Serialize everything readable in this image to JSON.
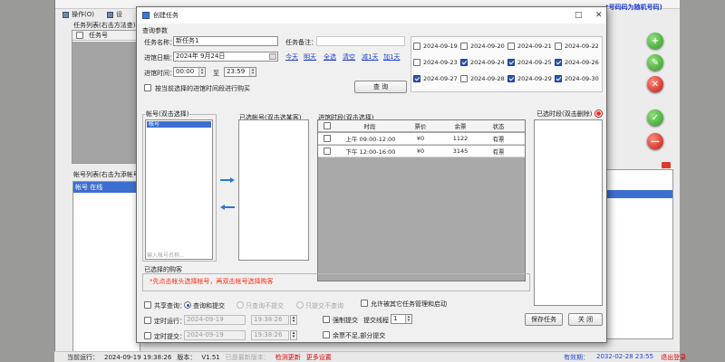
{
  "background": {
    "menu": {
      "operate": "操作(O)",
      "settings": "设"
    },
    "task_panel_title": "任务列表(右击方法查)",
    "task_grid_header": "任务号",
    "account_panel_title": "帐号列表(右击为添帐号",
    "account_item": "帐号 在线",
    "banner": "*号码码为随机号码)",
    "status": {
      "last_run_label": "当前运行：",
      "last_run": "2024-09-19 19:38:26",
      "version_label": "版本：",
      "version": "V1.51",
      "update_note": "已是最新版本：",
      "update_link": "检测更新",
      "more_settings": "更多设置",
      "expire_label": "有效期：",
      "expire": "2032-02-28 23:55",
      "logout": "退出登录"
    }
  },
  "dialog": {
    "title": "创建任务",
    "query_params_label": "查询参数",
    "task_name_label": "任务名称：",
    "task_name_value": "新任务1",
    "visit_date_label": "进馆日期：",
    "visit_date_value": "2024年 9月24日",
    "visit_time_label": "进馆时间：",
    "time_from": "00:00",
    "time_to_label": "至",
    "time_to": "23:59",
    "task_note_label": "任务备注：",
    "quick_links": [
      "今天",
      "明天",
      "全选",
      "清空",
      "减1天",
      "加1天"
    ],
    "only_selected_option": "按当前选择的进馆时间段进行购买",
    "query_button": "查 询",
    "dates": [
      {
        "date": "2024-09-19",
        "checked": false
      },
      {
        "date": "2024-09-20",
        "checked": false
      },
      {
        "date": "2024-09-21",
        "checked": false
      },
      {
        "date": "2024-09-22",
        "checked": false
      },
      {
        "date": "2024-09-23",
        "checked": false
      },
      {
        "date": "2024-09-24",
        "checked": true
      },
      {
        "date": "2024-09-25",
        "checked": true
      },
      {
        "date": "2024-09-26",
        "checked": true
      },
      {
        "date": "2024-09-27",
        "checked": true
      },
      {
        "date": "2024-09-28",
        "checked": false
      },
      {
        "date": "2024-09-29",
        "checked": true
      },
      {
        "date": "2024-09-30",
        "checked": true
      }
    ],
    "account_group_title": "帐号(双击选择)",
    "account_list_selected": "帐号",
    "account_search_placeholder": "输入帐号名称...",
    "selected_accounts_title": "已选帐号(双击选某客)",
    "slot_group_title": "进馆时段(双击选择)",
    "slot_headers": [
      "时段",
      "票价",
      "余票",
      "状态"
    ],
    "slots": [
      {
        "period": "上午 09:00-12:00",
        "price": "¥0",
        "remaining": "1122",
        "status": "有票"
      },
      {
        "period": "下午 12:00-16:00",
        "price": "¥0",
        "remaining": "3145",
        "status": "有票"
      }
    ],
    "selected_slots_title": "已选时段(双击删除)",
    "selected_visitors_title": "已选择的购客",
    "red_note": "*先点击帐头选择帐号，再双击帐号选择购客",
    "share_query_label": "共享查询：",
    "share_options": [
      "查询和提交",
      "只查询不提交",
      "只提交不查询"
    ],
    "allow_other_label": "允许被其它任务管理和启动",
    "schedule_run_label": "定时运行：",
    "schedule_run_date": "2024-09-19",
    "schedule_run_time": "19:38:26",
    "schedule_submit_label": "定时提交：",
    "schedule_submit_date": "2024-09-19",
    "schedule_submit_time": "19:38:26",
    "force_submit_label": "强制提交",
    "submit_threads_label": "提交线程",
    "submit_threads_value": "1",
    "partial_purchase_label": "余票不足,部分提交",
    "save_button": "保存任务",
    "close_button": "关 闭"
  }
}
